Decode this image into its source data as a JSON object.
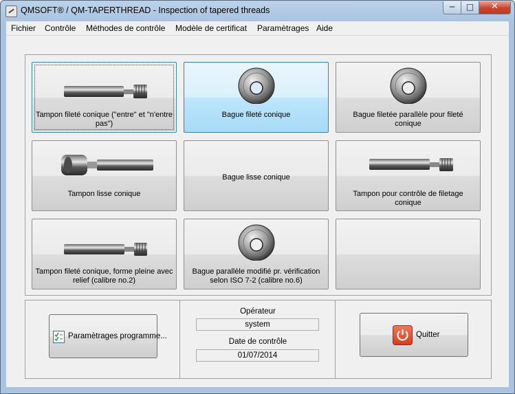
{
  "window": {
    "title": "QMSOFT® / QM-TAPERTHREAD - Inspection of tapered threads",
    "icon": "app-icon",
    "controls": {
      "minimize": "─",
      "maximize": "□",
      "close": "✕"
    }
  },
  "menu": [
    "Fichier",
    "Contrôle",
    "Méthodes de contrôle",
    "Modèle de certificat",
    "Paramètrages",
    "Aide"
  ],
  "tiles": [
    {
      "label": "Tampon fileté conique (\"entre\" et \"n'entre pas\")",
      "icon": "threaded-plug-gauge-icon",
      "state": "selected"
    },
    {
      "label": "Bague fileté conique",
      "icon": "ring-gauge-icon",
      "state": "hover"
    },
    {
      "label": "Bague filetée parallèle pour fileté conique",
      "icon": "ring-gauge-icon",
      "state": "normal"
    },
    {
      "label": "Tampon lisse conique",
      "icon": "plain-plug-gauge-icon",
      "state": "normal"
    },
    {
      "label": "Bague lisse conique",
      "icon": "",
      "state": "normal"
    },
    {
      "label": "Tampon pour contrôle de filetage conique",
      "icon": "threaded-plug-gauge-icon",
      "state": "normal"
    },
    {
      "label": "Tampon fileté conique, forme pleine avec relief (calibre no.2)",
      "icon": "threaded-plug-gauge-icon",
      "state": "normal"
    },
    {
      "label": "Bague parallèle modifié pr. vérification selon ISO 7-2 (calibre no.6)",
      "icon": "ring-gauge-icon",
      "state": "normal"
    },
    {
      "label": "",
      "icon": "",
      "state": "normal"
    }
  ],
  "settings_button": {
    "label": "Paramètrages programme...",
    "icon": "checklist-icon"
  },
  "operator": {
    "label": "Opérateur",
    "value": "system"
  },
  "check_date": {
    "label": "Date de contrôle",
    "value": "01/07/2014"
  },
  "quit_button": {
    "label": "Quitter",
    "icon": "power-icon",
    "accent": "#e0442b"
  }
}
